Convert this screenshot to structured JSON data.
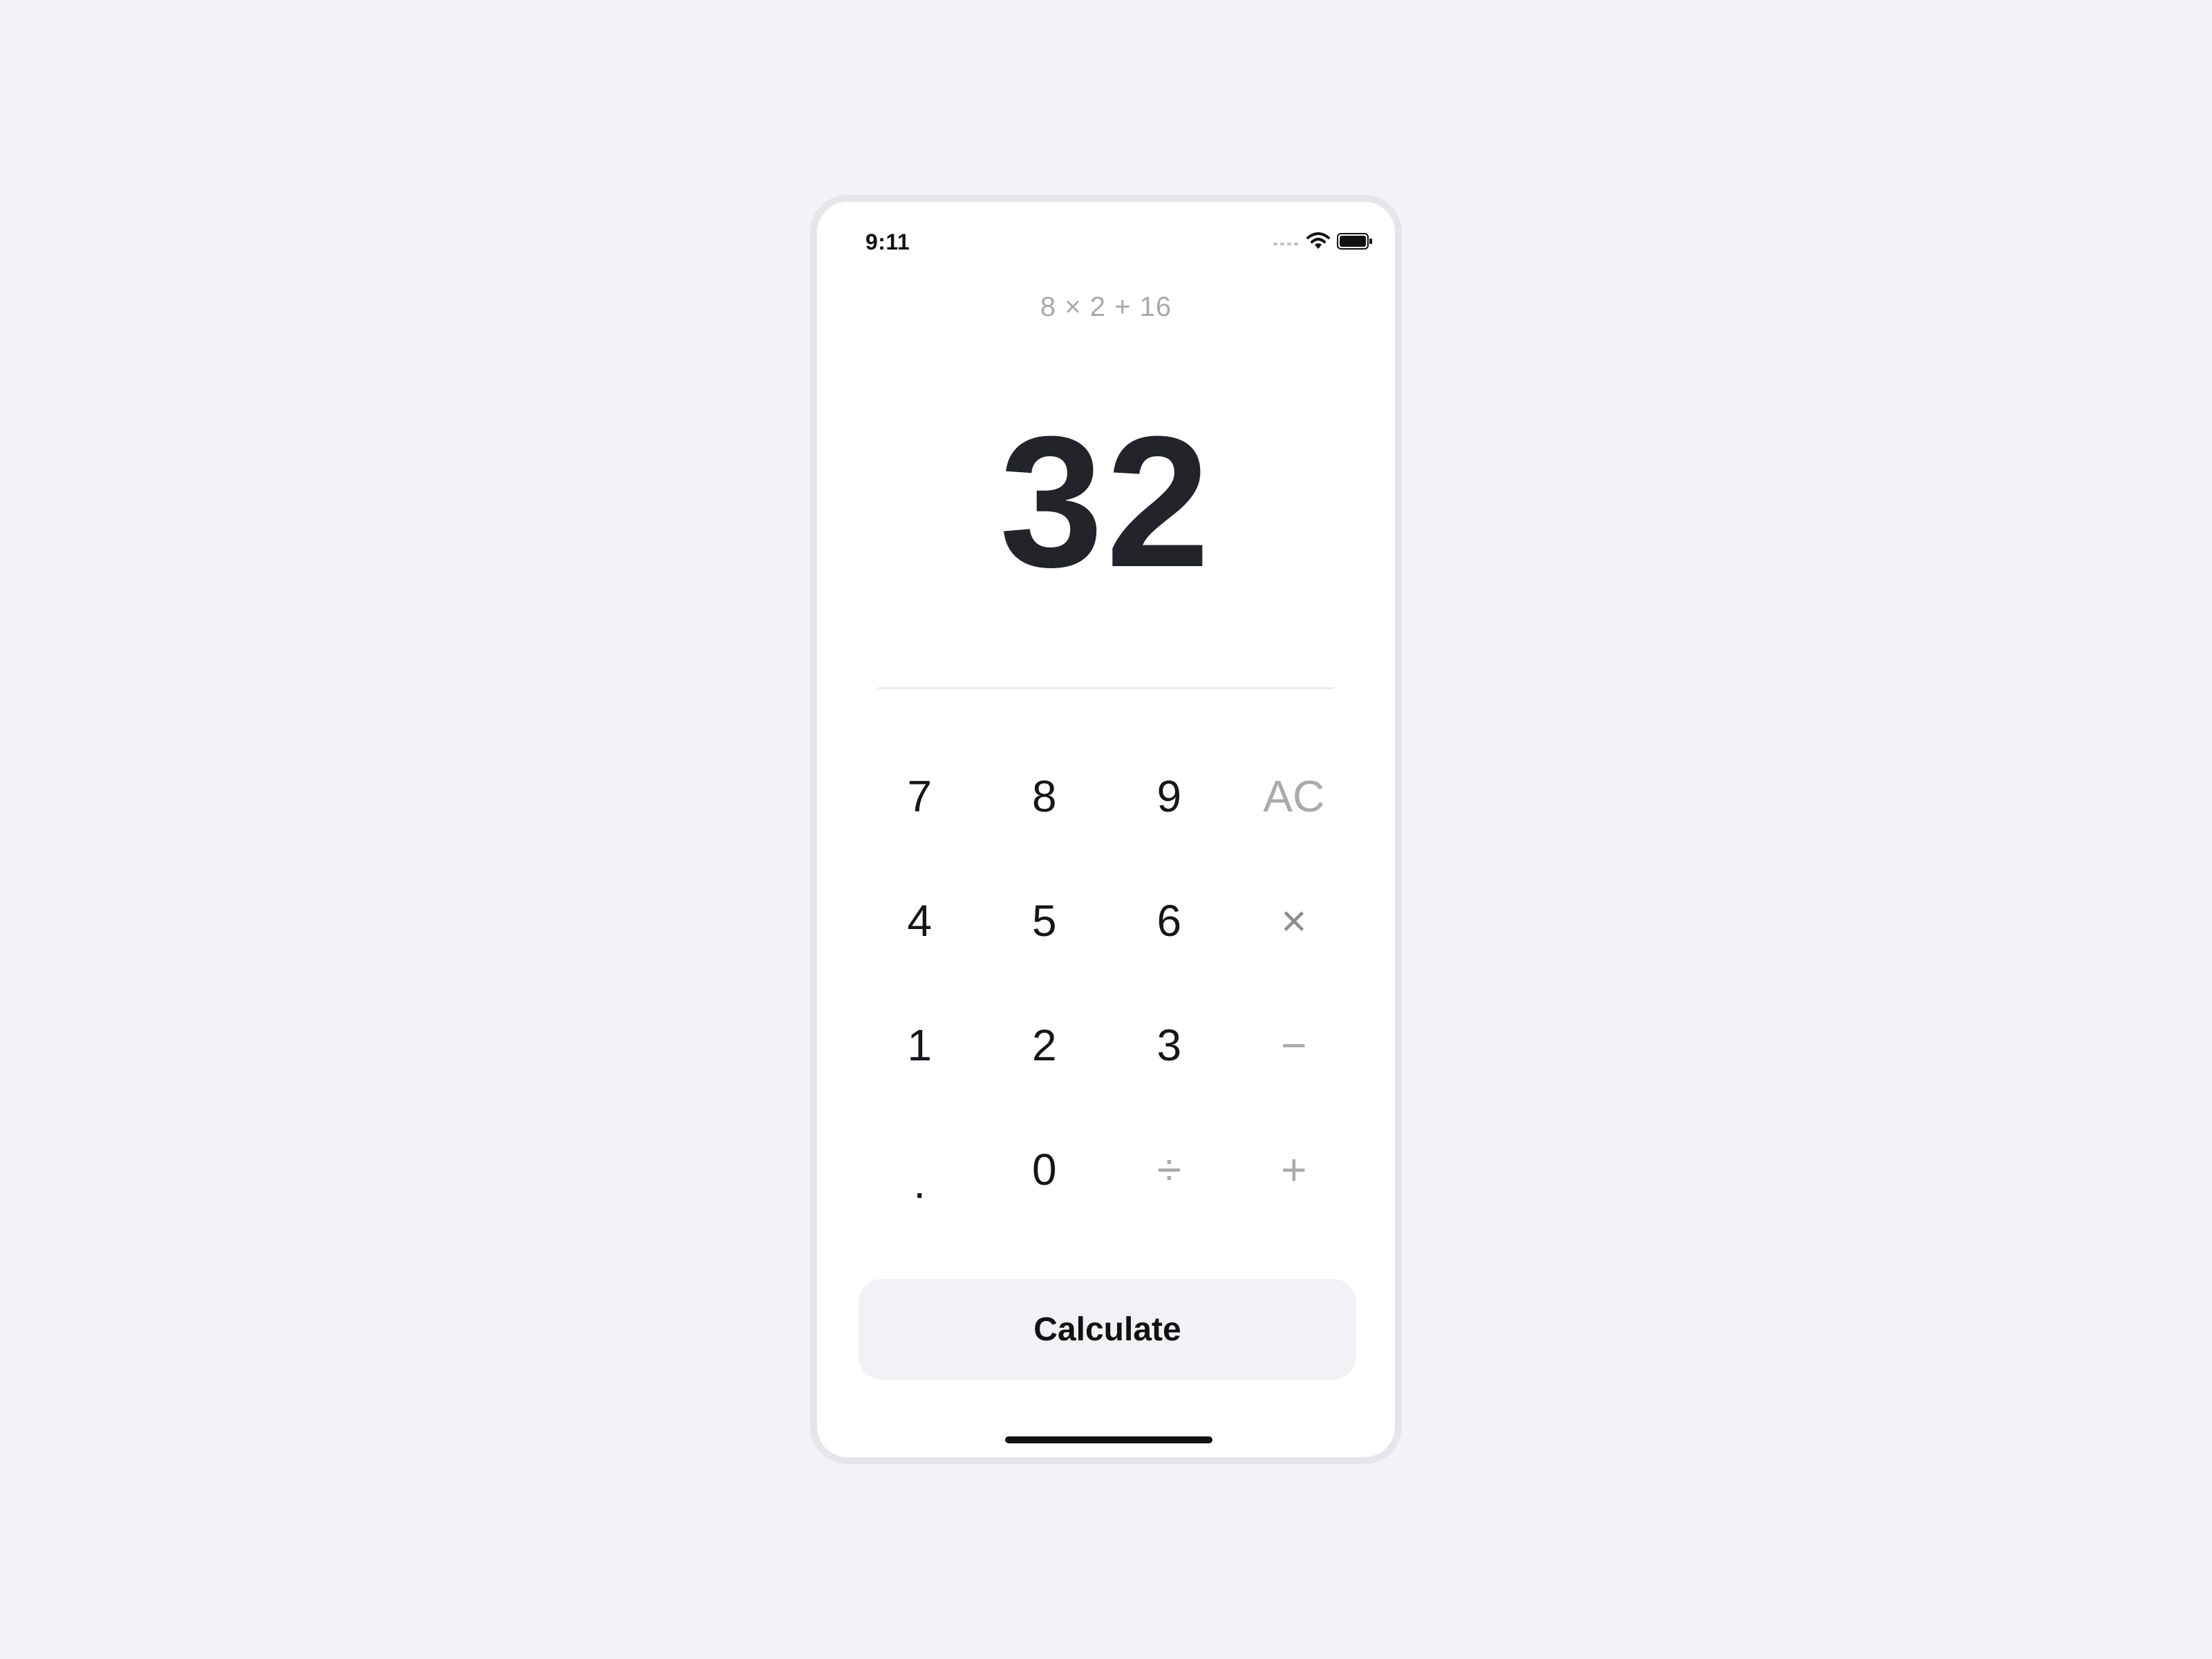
{
  "status_bar": {
    "time": "9:11",
    "icons": [
      "signal-icon",
      "wifi-icon",
      "battery-icon"
    ]
  },
  "display": {
    "expression": "8 × 2 + 16",
    "result": "32"
  },
  "keypad": {
    "keys": [
      {
        "label": "7",
        "kind": "digit"
      },
      {
        "label": "8",
        "kind": "digit"
      },
      {
        "label": "9",
        "kind": "digit"
      },
      {
        "label": "AC",
        "kind": "clear"
      },
      {
        "label": "4",
        "kind": "digit"
      },
      {
        "label": "5",
        "kind": "digit"
      },
      {
        "label": "6",
        "kind": "digit"
      },
      {
        "label": "×",
        "kind": "operator"
      },
      {
        "label": "1",
        "kind": "digit"
      },
      {
        "label": "2",
        "kind": "digit"
      },
      {
        "label": "3",
        "kind": "digit"
      },
      {
        "label": "−",
        "kind": "operator"
      },
      {
        "label": ".",
        "kind": "decimal"
      },
      {
        "label": "0",
        "kind": "digit"
      },
      {
        "label": "÷",
        "kind": "operator"
      },
      {
        "label": "+",
        "kind": "operator"
      }
    ]
  },
  "actions": {
    "calculate_label": "Calculate"
  },
  "colors": {
    "page_background": "#f2f2f7",
    "result_text": "#22242a",
    "muted_text": "#a8a8ad",
    "button_background": "#f2f2f6"
  }
}
